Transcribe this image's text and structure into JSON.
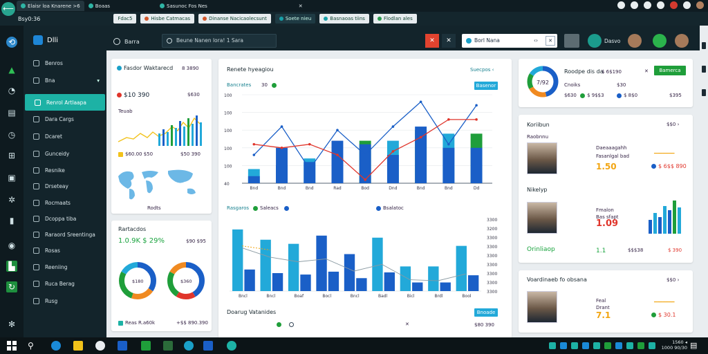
{
  "browser": {
    "tabs": [
      {
        "label": "Elaisr loa Knarene >6"
      },
      {
        "label": "Boaas"
      },
      {
        "label": "Sasunoc Fos Nes"
      },
      {
        "label": "✕"
      }
    ],
    "bookmarks": [
      {
        "label": "Fdac5"
      },
      {
        "label": "Hisbe Catmacas"
      },
      {
        "label": "Dinanse Nacicaolecsunt"
      },
      {
        "label": "Soete nieu"
      },
      {
        "label": "Basnaoas tiins"
      },
      {
        "label": "Flodlan ales"
      }
    ],
    "url_label": "Bsy0:36"
  },
  "sidebar": {
    "brand": "Dlli",
    "items": [
      {
        "label": "Benros"
      },
      {
        "label": "Bna",
        "has_chevron": true
      },
      {
        "label": "Renrol Artlaapa",
        "active": true
      },
      {
        "label": "Dara Cargs"
      },
      {
        "label": "Dcaret"
      },
      {
        "label": "Gunceidy"
      },
      {
        "label": "Resnike"
      },
      {
        "label": "Drseteay"
      },
      {
        "label": "Rocmaats"
      },
      {
        "label": "Dcoppa tiba"
      },
      {
        "label": "Raraord Sreentinga"
      },
      {
        "label": "Rosas"
      },
      {
        "label": "Reeniing"
      },
      {
        "label": "Ruca Berag"
      },
      {
        "label": "Rusg"
      }
    ]
  },
  "header": {
    "section": "Barra",
    "search_placeholder": "Beune Nanen lora! 1 Sara",
    "red_button": "✕",
    "x_button": "✕",
    "field_value": "Borl Nana",
    "field_arrow": "‹›",
    "field_box": "✕",
    "user_name": "Dasvo"
  },
  "card_stats": {
    "title": "Fasdor Waktarecd",
    "title_value": "8 3890",
    "red_value": "$10 390",
    "red_value_right": "$630",
    "small_label": "Teuab",
    "yellow_value": "$60.00 $50",
    "yellow_value_right": "$50 390",
    "legend": "Rodts"
  },
  "card_ratios": {
    "title": "Rartacdos",
    "value": "1.0.9K $ 29%",
    "value_right": "$90 $95",
    "donut1": "$180",
    "donut2": "$360",
    "footer_left": "Reas R.a60k",
    "footer_right": "+$$ 890.390"
  },
  "main_chart": {
    "title": "Renete hyeagiou",
    "link": "Suecpos ‹",
    "legend1": "Bancrates",
    "legend1_value": "30",
    "badge": "Basenor",
    "chart2_legend": "Rasgaros",
    "chart2_legend2": "Saleacs",
    "chart2_legend3": "Bsalatoc",
    "bottom_title": "Doarug Vatanides",
    "bottom_badge": "Bnoade",
    "bottom_value": "$80 390"
  },
  "chart_data": [
    {
      "type": "bar",
      "categories": [
        "Bnd",
        "Bnd",
        "Bnd",
        "Rad",
        "Bod",
        "Dnd",
        "Bnd",
        "Bnd",
        "Dd"
      ],
      "series": [
        {
          "values": [
            40,
            100,
            70,
            120,
            120,
            120,
            150,
            140,
            140
          ]
        },
        {
          "values": [
            20,
            50,
            60,
            70,
            110,
            80,
            160,
            100,
            100
          ]
        }
      ],
      "line_series": [
        {
          "values": [
            80,
            160,
            40,
            150,
            80,
            160,
            230,
            110,
            220
          ]
        },
        {
          "values": [
            110,
            100,
            110,
            80,
            10,
            90,
            130,
            180,
            180
          ]
        }
      ],
      "ylim": [
        0,
        250
      ],
      "yticks": [
        "100",
        "100",
        "100",
        "100",
        "100",
        "40"
      ]
    },
    {
      "type": "bar",
      "categories": [
        "Bncl",
        "Bncl",
        "Boaf",
        "Bocl",
        "Bncl",
        "Badl",
        "Bicl",
        "Brdl",
        "Bool"
      ],
      "values": [
        300,
        250,
        230,
        270,
        180,
        260,
        120,
        120,
        220
      ],
      "ylim": [
        0,
        350
      ],
      "yticks": [
        "3300",
        "3200",
        "3300",
        "3300",
        "3300",
        "3300",
        "3300",
        "3300",
        "3300"
      ]
    }
  ],
  "card_donut": {
    "center": "7/92",
    "title": "Roodpe dis da",
    "title_value": "$ 6$190",
    "green_badge": "Bamerca",
    "line1": "Cnoiks",
    "line1_value": "$ 9$$3",
    "line1_value2": "$ 8$0",
    "line1_right": "$30",
    "line2": "$630",
    "line2_right": "$395"
  },
  "card_profile1": {
    "title": "Koriibun",
    "top_right": "$$0 ›",
    "sub": "Raobnnu",
    "name1": "Daeaaagahh",
    "name2": "Fasanlgal bad",
    "yellow": "1.50",
    "red_right": "$ 6$$ 890",
    "section": "Nikelyp",
    "section_name": "Fmalon",
    "section_name2": "Bas sfapt",
    "red_value": "1.09",
    "footer_green": "Orinliaop",
    "footer_mid": "1.1",
    "footer_mid_right": "$$$38",
    "footer_red": "$ 390"
  },
  "card_profile2": {
    "title": "Voardinaeb fo obsana",
    "top_right": "$$0 ›",
    "name1": "Feal",
    "name2": "Drant",
    "yellow": "7.1",
    "red_right": "$ 6$0",
    "green_right": "$ 30.1"
  },
  "taskbar": {
    "clock_line1": "1560 ◂",
    "clock_line2": "1000 90/30"
  },
  "colors": {
    "accent": "#1db2a5",
    "dark": "#13242b",
    "blue": "#1a5fc7",
    "cyan": "#22a9d9",
    "green": "#1f9e3a",
    "red": "#e0352b",
    "orange": "#f2a512"
  }
}
